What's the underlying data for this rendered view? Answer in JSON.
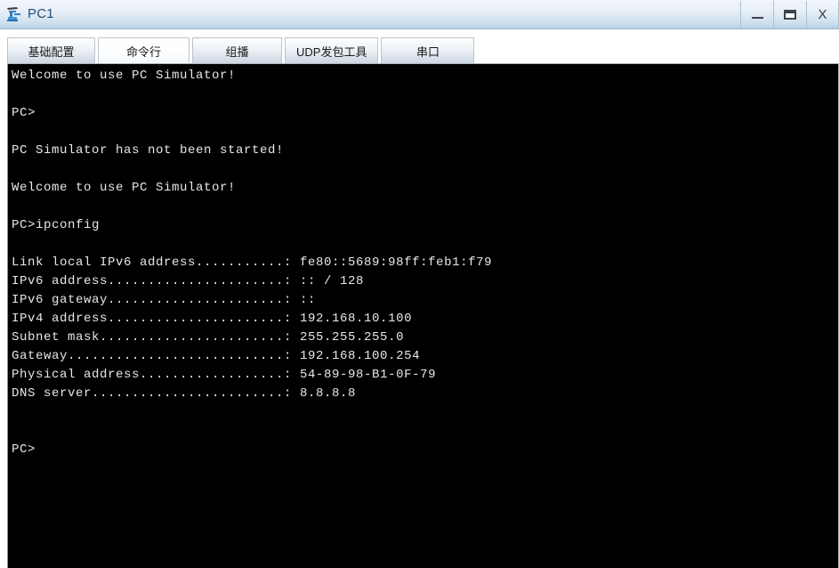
{
  "window": {
    "title": "PC1",
    "icon": "pc-device-icon",
    "controls": {
      "minimize_label": "—",
      "maximize_label": "☐",
      "close_label": "X"
    }
  },
  "tabs": [
    {
      "label": "基础配置",
      "active": false
    },
    {
      "label": "命令行",
      "active": true
    },
    {
      "label": "组播",
      "active": false
    },
    {
      "label": "UDP发包工具",
      "active": false
    },
    {
      "label": "串口",
      "active": false
    }
  ],
  "terminal": {
    "background_color": "#000000",
    "text_color": "#e8e8e8",
    "lines": [
      "Welcome to use PC Simulator!",
      "",
      "PC>",
      "",
      "PC Simulator has not been started!",
      "",
      "Welcome to use PC Simulator!",
      "",
      "PC>ipconfig",
      "",
      "Link local IPv6 address...........: fe80::5689:98ff:feb1:f79",
      "IPv6 address......................: :: / 128",
      "IPv6 gateway......................: ::",
      "IPv4 address......................: 192.168.10.100",
      "Subnet mask.......................: 255.255.255.0",
      "Gateway...........................: 192.168.100.254",
      "Physical address..................: 54-89-98-B1-0F-79",
      "DNS server........................: 8.8.8.8",
      "",
      "",
      "PC>",
      "",
      "",
      "",
      "",
      ""
    ],
    "ipconfig": {
      "command": "ipconfig",
      "prompt": "PC>",
      "fields": [
        {
          "label": "Link local IPv6 address",
          "value": "fe80::5689:98ff:feb1:f79"
        },
        {
          "label": "IPv6 address",
          "value": ":: / 128"
        },
        {
          "label": "IPv6 gateway",
          "value": "::"
        },
        {
          "label": "IPv4 address",
          "value": "192.168.10.100"
        },
        {
          "label": "Subnet mask",
          "value": "255.255.255.0"
        },
        {
          "label": "Gateway",
          "value": "192.168.100.254"
        },
        {
          "label": "Physical address",
          "value": "54-89-98-B1-0F-79"
        },
        {
          "label": "DNS server",
          "value": "8.8.8.8"
        }
      ]
    }
  }
}
